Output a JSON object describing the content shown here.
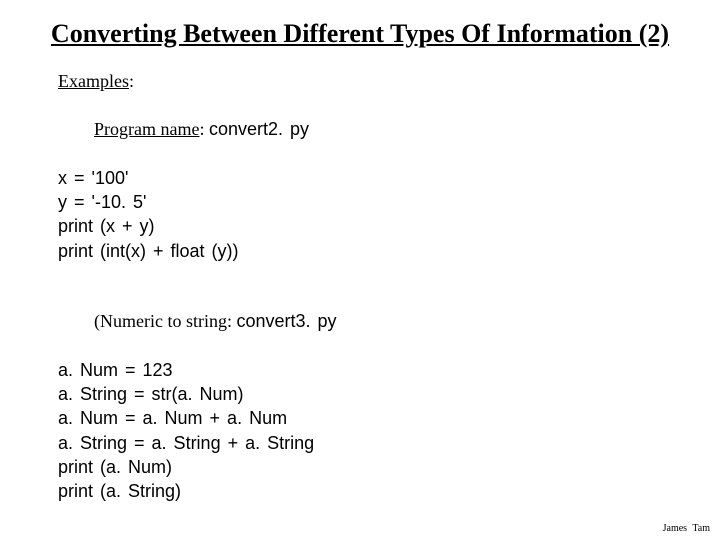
{
  "title": "Converting Between Different Types Of Information (2)",
  "block1": {
    "heading": "Examples",
    "heading_suffix": ":",
    "program_label": "Program name",
    "program_sep": ": ",
    "program_name": "convert2. py",
    "lines": [
      "x = '100'",
      "y = '-10. 5'",
      "print (x + y)",
      "print (int(x) + float (y))"
    ]
  },
  "block2": {
    "intro_prefix": "(Numeric to string",
    "intro_sep": ": ",
    "program_name": "convert3. py",
    "lines": [
      "a. Num = 123",
      "a. String = str(a. Num)",
      "a. Num = a. Num + a. Num",
      "a. String = a. String + a. String",
      "print (a. Num)",
      "print (a. String)"
    ]
  },
  "footer": "James Tam"
}
